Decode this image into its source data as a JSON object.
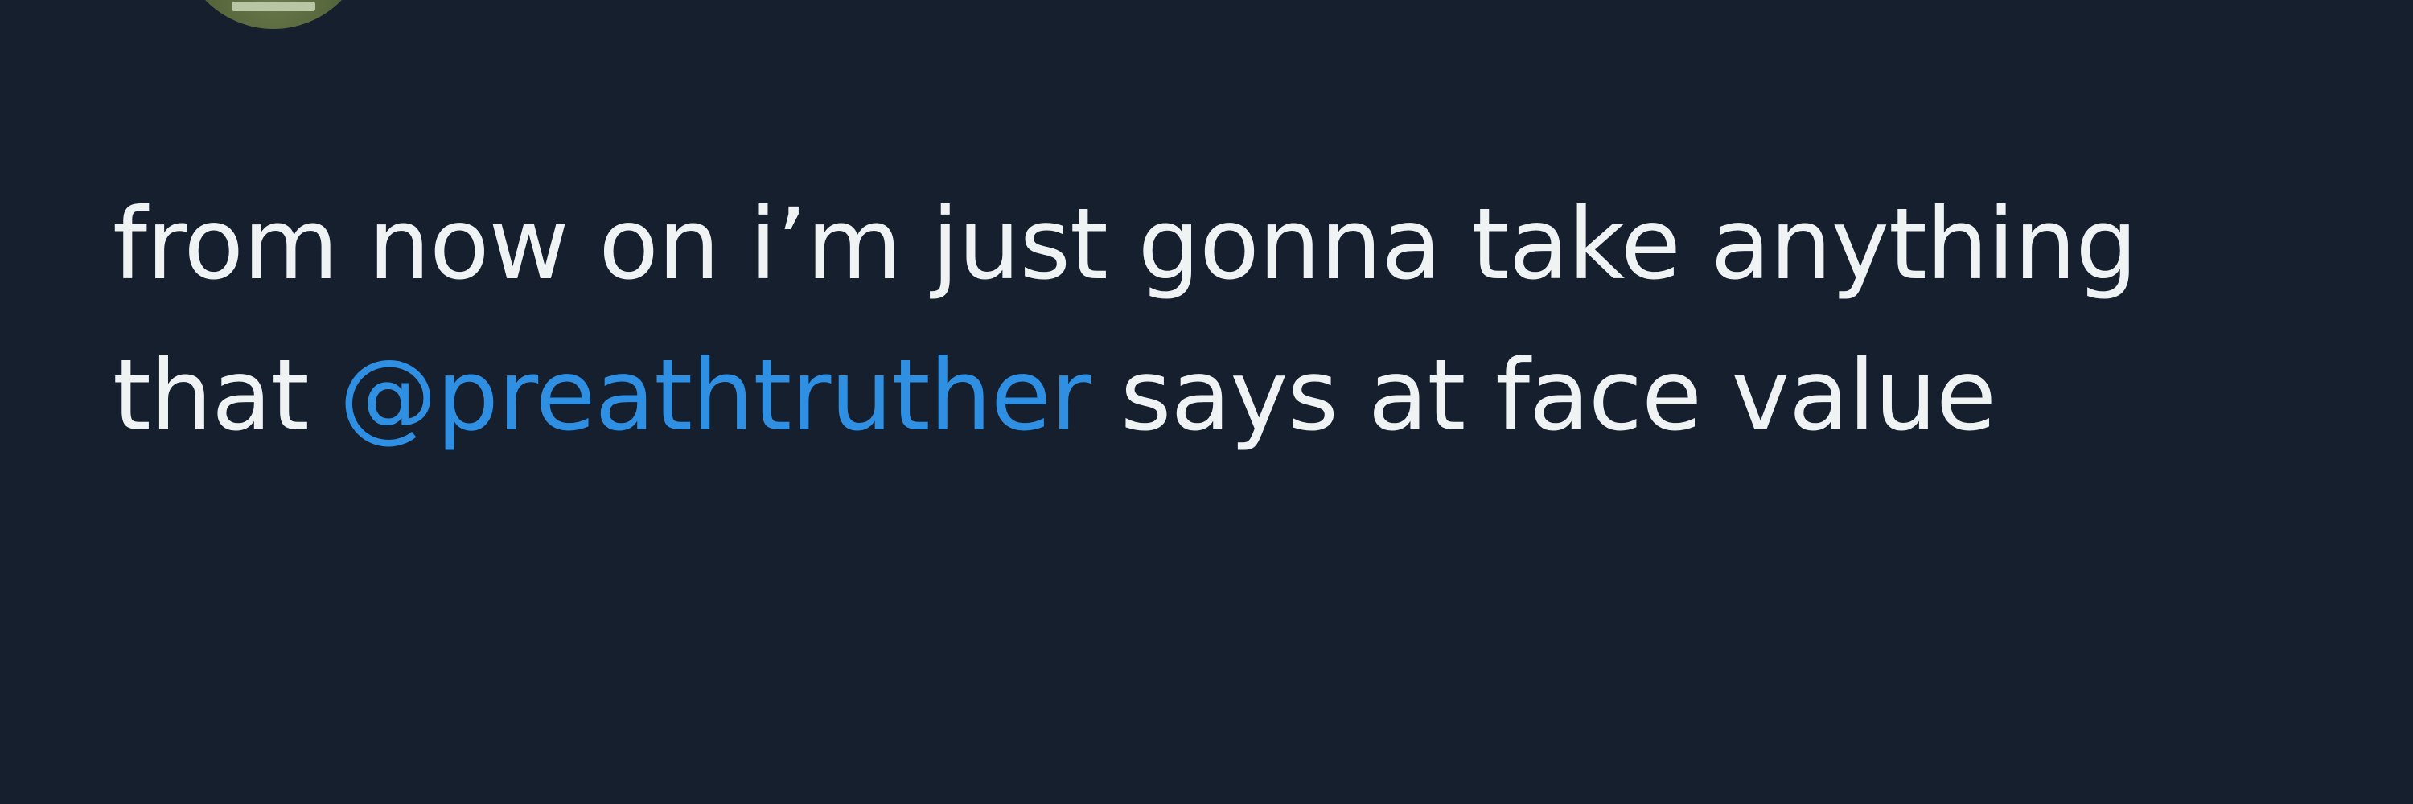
{
  "tweet": {
    "text_before_mention": "from now on i’m just gonna take anything that ",
    "mention": "@preathtruther",
    "text_after_mention": " says at face value",
    "mention_color": "#2f90e3",
    "text_color": "#eff3f4",
    "background_color": "#151f2d"
  },
  "author": {
    "avatar_icon": "avatar-image"
  }
}
